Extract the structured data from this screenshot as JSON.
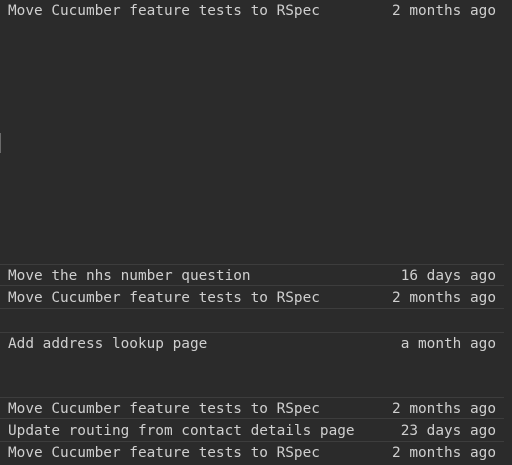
{
  "blame": {
    "entries": [
      {
        "message": "Move Cucumber feature tests to RSpec",
        "age": "2 months ago"
      },
      {
        "message": "Move the nhs number question",
        "age": "16 days ago"
      },
      {
        "message": "Move Cucumber feature tests to RSpec",
        "age": "2 months ago"
      },
      {
        "message": "Add address lookup page",
        "age": "a month ago"
      },
      {
        "message": "Move Cucumber feature tests to RSpec",
        "age": "2 months ago"
      },
      {
        "message": "Update routing from contact details page",
        "age": "23 days ago"
      },
      {
        "message": "Move Cucumber feature tests to RSpec",
        "age": "2 months ago"
      }
    ]
  }
}
